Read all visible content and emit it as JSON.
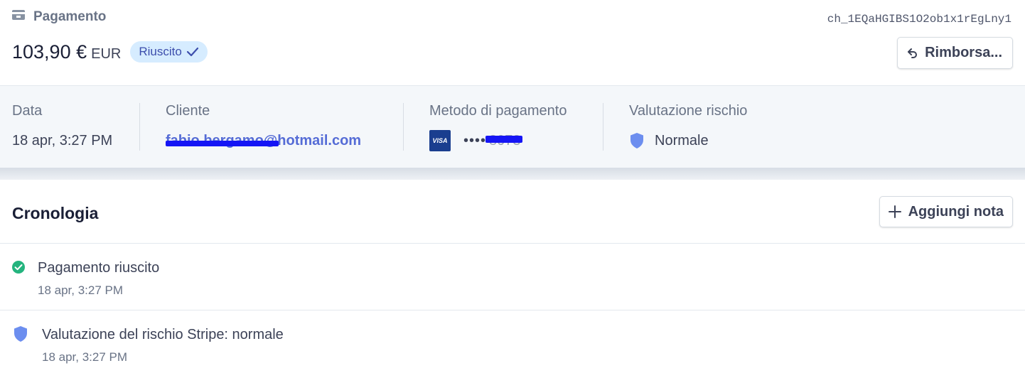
{
  "header": {
    "type_label": "Pagamento",
    "type_icon": "payment-card-icon",
    "charge_id": "ch_1EQaHGIBS1O2ob1x1rEgLny1",
    "amount": "103,90 €",
    "currency": "EUR",
    "status_badge": "Riuscito",
    "status_color": "#d6ecff",
    "refund_label": "Rimborsa..."
  },
  "summary": {
    "date": {
      "label": "Data",
      "value": "18 apr, 3:27 PM"
    },
    "customer": {
      "label": "Cliente",
      "value": "fabio.bergamo@hotmail.com"
    },
    "payment_method": {
      "label": "Metodo di pagamento",
      "brand": "VISA",
      "dots": "••••",
      "last4": "8073"
    },
    "risk": {
      "label": "Valutazione rischio",
      "value": "Normale"
    }
  },
  "timeline": {
    "title": "Cronologia",
    "add_note_label": "Aggiungi nota",
    "events": [
      {
        "title": "Pagamento riuscito",
        "time": "18 apr, 3:27 PM",
        "icon": "check-circle-icon"
      },
      {
        "title": "Valutazione del rischio Stripe: normale",
        "time": "18 apr, 3:27 PM",
        "icon": "shield-icon"
      }
    ]
  },
  "colors": {
    "accent": "#556cd6",
    "success": "#24b47e",
    "shield": "#6c8eef",
    "redaction": "#1515f5"
  }
}
